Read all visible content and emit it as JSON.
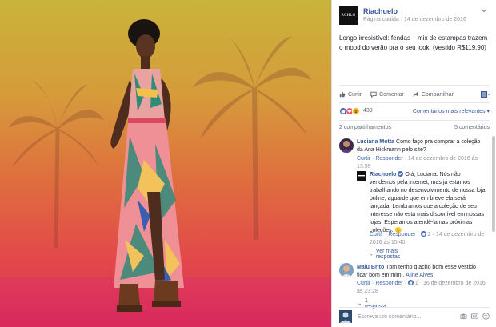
{
  "post": {
    "page_name": "Riachuelo",
    "logo_text": "RCHLO",
    "meta_source": "Página curtida",
    "meta_sep": " · ",
    "meta_date": "14 de dezembro de 2016",
    "caption": "Longo irresistível: fendas + mix de estampas trazem o mood do verão pra o seu look. (vestido R$119,90)"
  },
  "actions": [
    {
      "icon": "like-icon",
      "label": "Curtir"
    },
    {
      "icon": "comment-icon",
      "label": "Comentar"
    },
    {
      "icon": "share-icon",
      "label": "Compartilhar"
    }
  ],
  "reactions": {
    "count": "439",
    "sort_label": "Comentários mais relevantes ▾",
    "shares": "2 compartilhamentos",
    "comments": "5 comentários"
  },
  "comments": [
    {
      "author": "Luciana Motta",
      "text": "Como faço pra comprar a coleção da Ana Hickmann pelo site?",
      "like": "Curtir",
      "reply": "Responder",
      "time": "14 de dezembro de 2016 às 13:59"
    },
    {
      "author": "Riachuelo",
      "text": "Olá, Luciana. Nós não vendemos pela internet, mas já estamos trabalhando no desenvolvimento de nossa loja online, aguarde que em breve ela será lançada. Lembramos que a coleção de seu interesse não está mais disponível em nossas lojas. Esperamos atendê-la nas próximas coleções. 🙂",
      "like": "Curtir",
      "reply": "Responder",
      "likes": "2",
      "time": "14 de dezembro de 2016 às 15:40"
    },
    {
      "author": "Malu Brito",
      "text": "Tbm tenho q acho bom esse vestido ficar bom em mim..",
      "mention": "Aline Alves",
      "like": "Curtir",
      "reply": "Responder",
      "likes": "1",
      "time": "16 de dezembro de 2016 às 23:28"
    }
  ],
  "more_replies": "Ver mais respostas",
  "one_reply": "1 resposta",
  "comment_input": {
    "placeholder": "Escreva um comentário..."
  },
  "colors": {
    "link": "#365899",
    "accent": "#4267b2",
    "bg_top": "#c9b43a",
    "bg_bottom": "#d8325a"
  }
}
